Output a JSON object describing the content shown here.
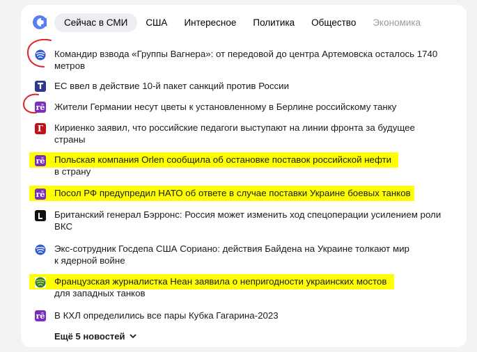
{
  "header": {
    "tabs": [
      {
        "label": "Сейчас в СМИ"
      },
      {
        "label": "США"
      },
      {
        "label": "Интересное"
      },
      {
        "label": "Политика"
      },
      {
        "label": "Общество"
      },
      {
        "label": "Экономика"
      }
    ]
  },
  "news": [
    {
      "title_line1": "Командир взвода «Группы Вагнера»: от передовой до центра Артемовска осталось 1740",
      "title_line2": "метров",
      "source_icon": "globe-icon"
    },
    {
      "title_line1": "ЕС ввел в действие 10-й пакет санкций против России",
      "title_line2": "",
      "source_icon": "t-icon"
    },
    {
      "title_line1": "Жители Германии несут цветы к установленному в Берлине российскому танку",
      "title_line2": "",
      "source_icon": "re-icon"
    },
    {
      "title_line1": "Кириенко заявил, что российские педагоги выступают на линии фронта за будущее",
      "title_line2": "страны",
      "source_icon": "g-icon"
    },
    {
      "title_line1": "Польская компания Orlen сообщила об остановке поставок российской нефти",
      "title_line2": "в страну",
      "source_icon": "re-icon"
    },
    {
      "title_line1": "Посол РФ предупредил НАТО об ответе в случае поставки Украине боевых танков",
      "title_line2": "",
      "source_icon": "re-icon"
    },
    {
      "title_line1": "Британский генерал Бэрронс: Россия может изменить ход спецоперации усилением роли",
      "title_line2": "ВКС",
      "source_icon": "l-icon"
    },
    {
      "title_line1": "Экс-сотрудник Госдепа США Сориано: действия Байдена на Украине толкают мир",
      "title_line2": "к ядерной войне",
      "source_icon": "globe-icon"
    },
    {
      "title_line1": "Французская журналистка Неан заявила о непригодности украинских мостов",
      "title_line2": "для западных танков",
      "source_icon": "green-globe-icon"
    },
    {
      "title_line1": "В КХЛ определились все пары Кубка Гагарина-2023",
      "title_line2": "",
      "source_icon": "re-icon"
    }
  ],
  "more_label": "Ещё 5 новостей",
  "colors": {
    "highlight": "#ffff00",
    "scribble": "#e0202a",
    "re_purple": "#7b2fbf"
  }
}
